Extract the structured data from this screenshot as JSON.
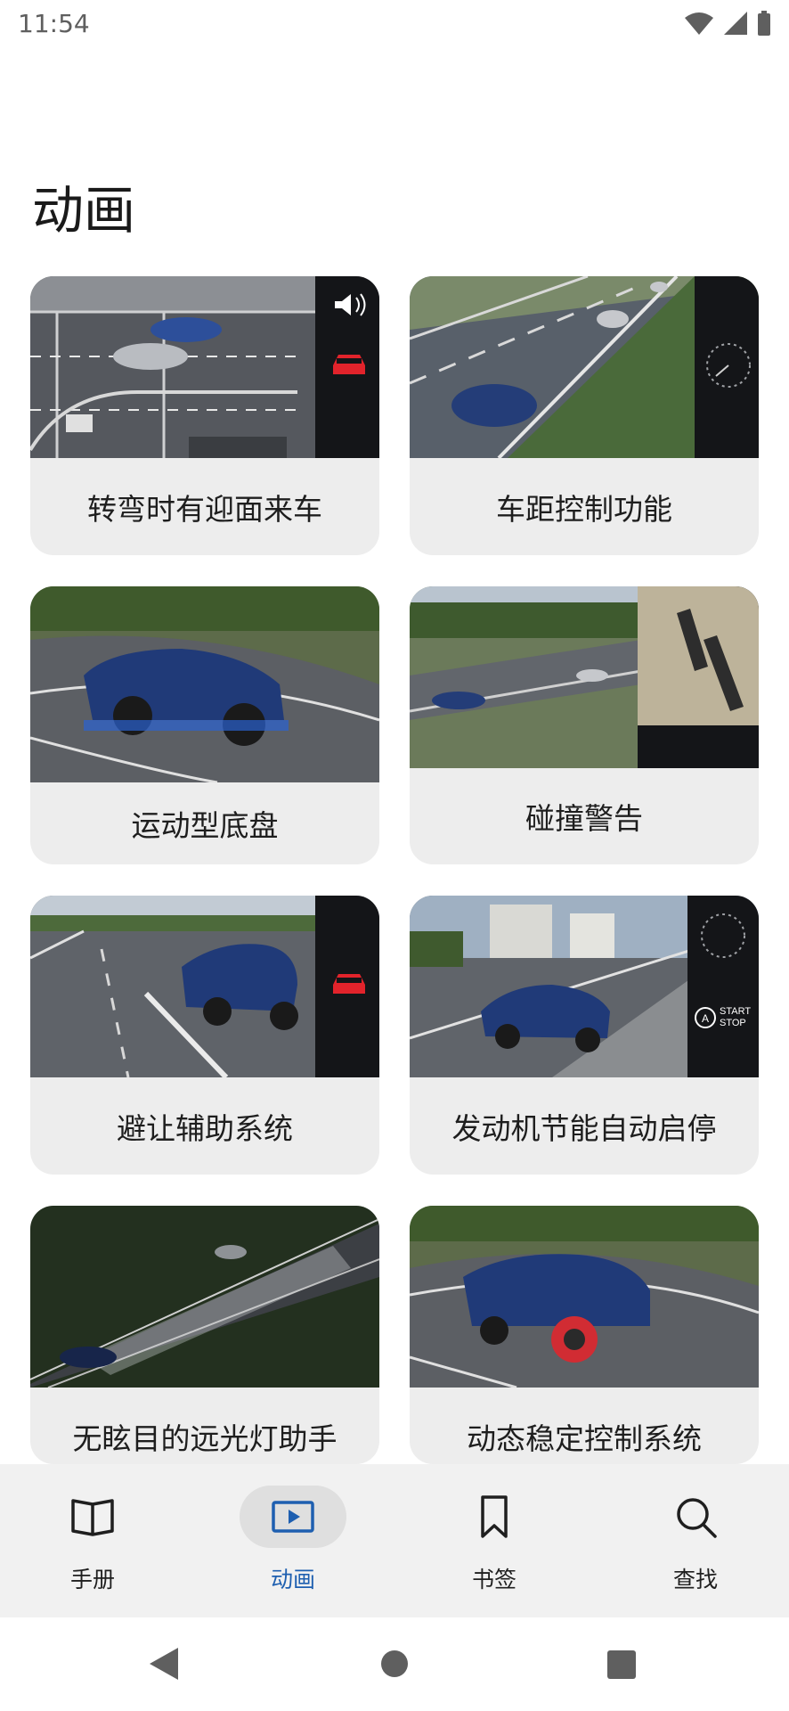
{
  "status_bar": {
    "time": "11:54"
  },
  "page": {
    "title": "动画"
  },
  "animations": [
    {
      "label": "转弯时有迎面来车"
    },
    {
      "label": "车距控制功能"
    },
    {
      "label": "运动型底盘"
    },
    {
      "label": "碰撞警告"
    },
    {
      "label": "避让辅助系统"
    },
    {
      "label": "发动机节能自动启停"
    },
    {
      "label": "无眩目的远光灯助手"
    },
    {
      "label": "动态稳定控制系统"
    }
  ],
  "thumb_overlay": {
    "start_stop_line1": "START",
    "start_stop_line2": "STOP",
    "start_stop_letter": "A"
  },
  "bottom_nav": {
    "items": [
      {
        "label": "手册",
        "icon": "book-icon",
        "active": false
      },
      {
        "label": "动画",
        "icon": "play-video-icon",
        "active": true
      },
      {
        "label": "书签",
        "icon": "bookmark-icon",
        "active": false
      },
      {
        "label": "查找",
        "icon": "search-icon",
        "active": false
      }
    ],
    "active_color": "#1e5fb0"
  },
  "system_nav": {
    "icons": [
      "back-icon",
      "home-icon",
      "recents-icon"
    ]
  }
}
